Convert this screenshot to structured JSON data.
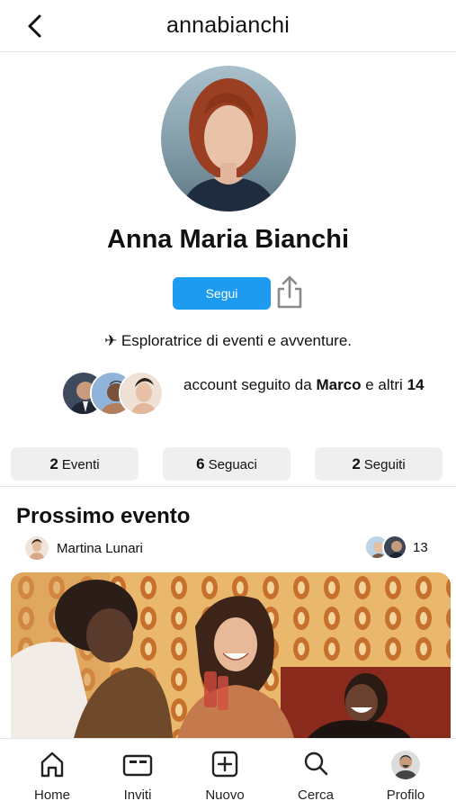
{
  "header": {
    "title": "annabianchi"
  },
  "profile": {
    "name": "Anna Maria Bianchi",
    "follow_label": "Segui",
    "bio": "✈ Esploratrice di eventi e avventure.",
    "mutual": {
      "prefix": "account seguito da ",
      "name": "Marco",
      "middle": " e altri ",
      "count": "14"
    }
  },
  "stats": [
    {
      "value": "2",
      "label": "Eventi"
    },
    {
      "value": "6",
      "label": "Seguaci"
    },
    {
      "value": "2",
      "label": "Seguiti"
    }
  ],
  "next_event": {
    "section_title": "Prossimo evento",
    "organizer": "Martina Lunari",
    "attendee_count": "13"
  },
  "tabbar": [
    {
      "label": "Home",
      "icon": "home-icon"
    },
    {
      "label": "Inviti",
      "icon": "ticket-icon"
    },
    {
      "label": "Nuovo",
      "icon": "plus-square-icon"
    },
    {
      "label": "Cerca",
      "icon": "search-icon"
    },
    {
      "label": "Profilo",
      "icon": "profile-avatar-icon"
    }
  ],
  "colors": {
    "accent": "#1d9bf0",
    "stat_bg": "#efefef"
  }
}
